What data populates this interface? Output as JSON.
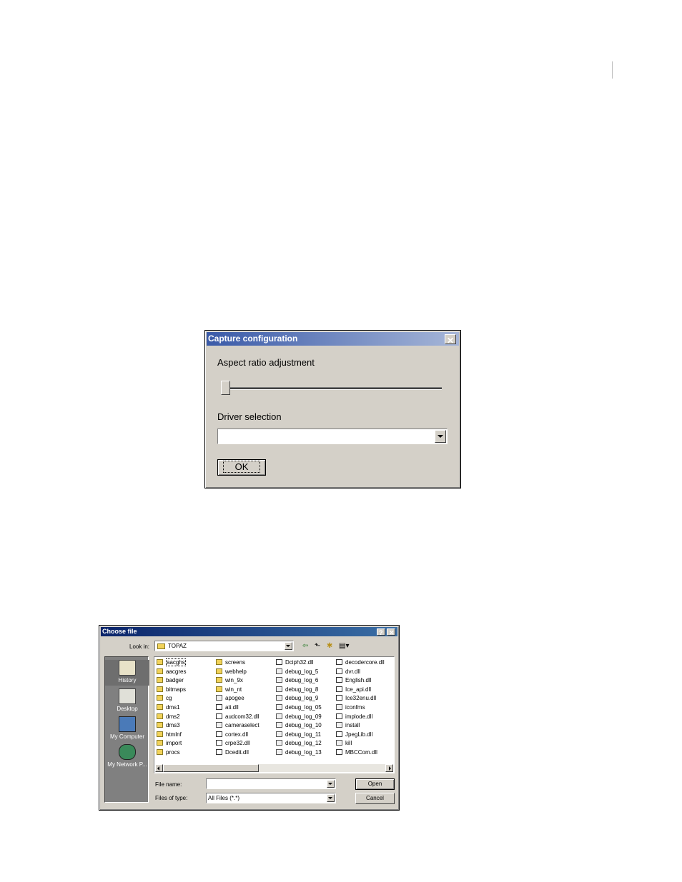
{
  "capture_dialog": {
    "title": "Capture configuration",
    "close_glyph": "✕",
    "aspect_label": "Aspect ratio adjustment",
    "aspect_value": 0,
    "driver_label": "Driver selection",
    "driver_value": "",
    "ok_label": "OK"
  },
  "file_dialog": {
    "title": "Choose file",
    "help_glyph": "?",
    "close_glyph": "✕",
    "look_in_label": "Look in:",
    "look_in_value": "TOPAZ",
    "places": [
      {
        "label": "History",
        "icon": "history-icon"
      },
      {
        "label": "Desktop",
        "icon": "desktop-icon"
      },
      {
        "label": "My Computer",
        "icon": "my-computer-icon"
      },
      {
        "label": "My Network P...",
        "icon": "network-places-icon"
      }
    ],
    "columns": [
      [
        {
          "name": "aacghs",
          "kind": "folder"
        },
        {
          "name": "aacgres",
          "kind": "folder"
        },
        {
          "name": "badger",
          "kind": "folder"
        },
        {
          "name": "bitmaps",
          "kind": "folder"
        },
        {
          "name": "cg",
          "kind": "folder"
        },
        {
          "name": "dms1",
          "kind": "folder"
        },
        {
          "name": "dms2",
          "kind": "folder"
        },
        {
          "name": "dms3",
          "kind": "folder"
        },
        {
          "name": "htmlnf",
          "kind": "folder"
        },
        {
          "name": "import",
          "kind": "folder"
        },
        {
          "name": "procs",
          "kind": "folder"
        }
      ],
      [
        {
          "name": "screens",
          "kind": "folder"
        },
        {
          "name": "webhelp",
          "kind": "folder"
        },
        {
          "name": "win_9x",
          "kind": "folder"
        },
        {
          "name": "win_nt",
          "kind": "folder"
        },
        {
          "name": "apogee",
          "kind": "file"
        },
        {
          "name": "ati.dll",
          "kind": "dll"
        },
        {
          "name": "audcom32.dll",
          "kind": "dll"
        },
        {
          "name": "cameraselect",
          "kind": "file"
        },
        {
          "name": "cortex.dll",
          "kind": "dll"
        },
        {
          "name": "crpe32.dll",
          "kind": "dll"
        },
        {
          "name": "Dcedit.dll",
          "kind": "dll"
        }
      ],
      [
        {
          "name": "Dciph32.dll",
          "kind": "dll"
        },
        {
          "name": "debug_log_5",
          "kind": "file"
        },
        {
          "name": "debug_log_6",
          "kind": "file"
        },
        {
          "name": "debug_log_8",
          "kind": "file"
        },
        {
          "name": "debug_log_9",
          "kind": "file"
        },
        {
          "name": "debug_log_05",
          "kind": "file"
        },
        {
          "name": "debug_log_09",
          "kind": "file"
        },
        {
          "name": "debug_log_10",
          "kind": "file"
        },
        {
          "name": "debug_log_11",
          "kind": "file"
        },
        {
          "name": "debug_log_12",
          "kind": "file"
        },
        {
          "name": "debug_log_13",
          "kind": "file"
        }
      ],
      [
        {
          "name": "decodercore.dll",
          "kind": "dll"
        },
        {
          "name": "dvr.dll",
          "kind": "dll"
        },
        {
          "name": "English.dll",
          "kind": "dll"
        },
        {
          "name": "Ice_api.dll",
          "kind": "dll"
        },
        {
          "name": "Ice32enu.dll",
          "kind": "dll"
        },
        {
          "name": "iconfms",
          "kind": "file"
        },
        {
          "name": "implode.dll",
          "kind": "dll"
        },
        {
          "name": "install",
          "kind": "file"
        },
        {
          "name": "JpegLib.dll",
          "kind": "dll"
        },
        {
          "name": "kill",
          "kind": "file"
        },
        {
          "name": "MBCCom.dll",
          "kind": "dll"
        }
      ]
    ],
    "file_name_label": "File name:",
    "file_name_value": "",
    "file_type_label": "Files of type:",
    "file_type_value": "All Files (*.*)",
    "open_label": "Open",
    "cancel_label": "Cancel",
    "toolbar": {
      "back": "⇦",
      "up": "⬑",
      "new_folder": "✱",
      "view": "▤▾"
    }
  }
}
